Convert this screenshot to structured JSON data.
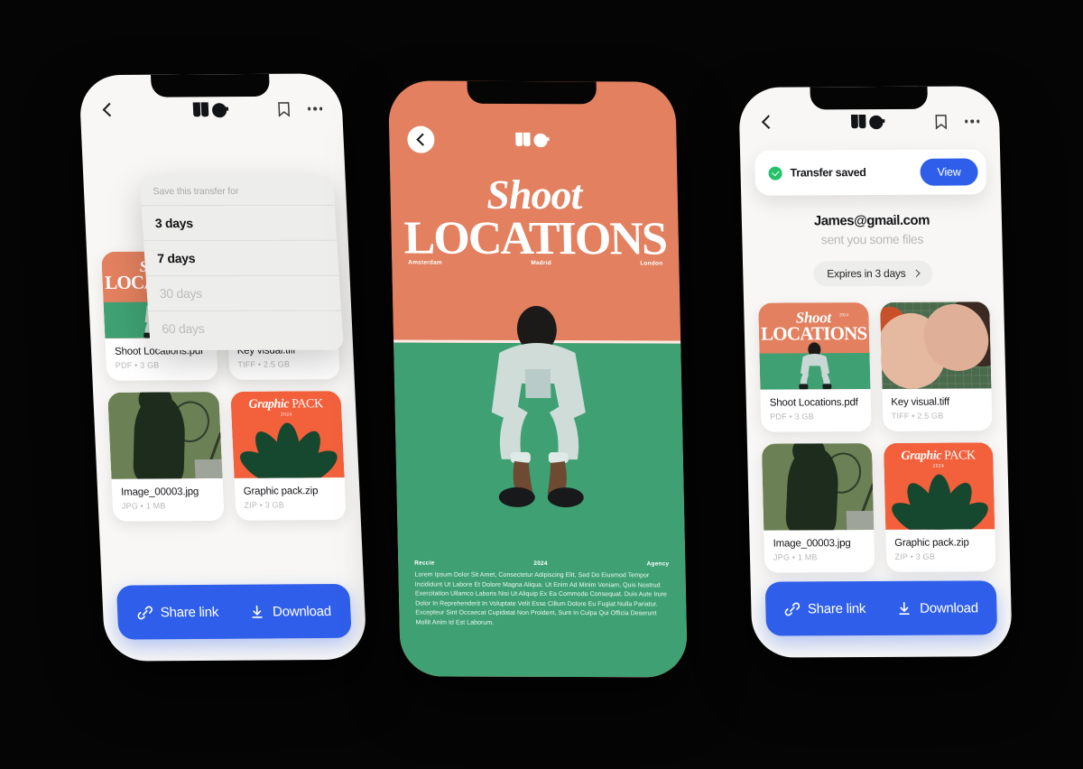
{
  "background_color": "#050505",
  "palette": {
    "orange": "#E2805F",
    "orange_bright": "#F2603C",
    "green": "#3FA173",
    "green_dark": "#16472F",
    "blue": "#2F5FEA",
    "success_green": "#25C16A",
    "surface": "#F8F7F5"
  },
  "phone1": {
    "name": "transfer-detail-with-expiry-dropdown",
    "topbar": {
      "back_icon": "chevron-left-icon",
      "logo": "we-logo",
      "bookmark_icon": "bookmark-icon",
      "more_icon": "more-horizontal-icon"
    },
    "dropdown": {
      "header": "Save this transfer for",
      "options": [
        {
          "label": "3 days",
          "state": "active"
        },
        {
          "label": "7 days",
          "state": "active"
        },
        {
          "label": "30 days",
          "state": "muted"
        },
        {
          "label": "60 days",
          "state": "muted"
        }
      ]
    },
    "files": [
      {
        "name": "Shoot Locations.pdf",
        "sub": "PDF  •  3 GB",
        "art": "shoot-cover"
      },
      {
        "name": "Key visual.tiff",
        "sub": "TIFF  •  2.5 GB",
        "art": "faces-photo"
      },
      {
        "name": "Image_00003.jpg",
        "sub": "JPG  •  1 MB",
        "art": "court-shadow"
      },
      {
        "name": "Graphic pack.zip",
        "sub": "ZIP  •  3 GB",
        "art": "graphic-pack"
      }
    ],
    "actions": {
      "share_icon": "link-icon",
      "share_label": "Share link",
      "download_icon": "download-icon",
      "download_label": "Download"
    }
  },
  "phone2": {
    "name": "shoot-locations-cover",
    "back_icon": "chevron-left-circle-icon",
    "logo": "we-logo",
    "title_line1": "Shoot",
    "title_line2": "LOCATIONS",
    "cities": [
      "Amsterdam",
      "Madrid",
      "London"
    ],
    "footer": {
      "left": "Reccie",
      "center": "2024",
      "right": "Agency",
      "body": "Lorem Ipsum Dolor Sit Amet, Consectetur Adipiscing Elit, Sed Do Eiusmod Tempor Incididunt Ut Labore Et Dolore Magna Aliqua. Ut Enim Ad Minim Veniam, Quis Nostrud Exercitation Ullamco Laboris Nisi Ut Aliquip Ex Ea Commodo Consequat. Duis Aute Irure Dolor In Reprehenderit In Voluptate Velit Esse Cillum Dolore Eu Fugiat Nulla Pariatur. Excepteur Sint Occaecat Cupidatat Non Proident, Sunt In Culpa Qui Officia Deserunt Mollit Anim Id Est Laborum."
    }
  },
  "phone3": {
    "name": "transfer-saved-confirmation",
    "topbar": {
      "back_icon": "chevron-left-icon",
      "logo": "we-logo",
      "bookmark_icon": "bookmark-icon",
      "more_icon": "more-horizontal-icon"
    },
    "toast": {
      "status_icon": "check-circle-icon",
      "message": "Transfer saved",
      "button_label": "View"
    },
    "sender_email": "James@gmail.com",
    "sender_subtitle": "sent you some files",
    "expires_label": "Expires in 3 days",
    "expires_chevron": "chevron-right-icon",
    "files": [
      {
        "name": "Shoot Locations.pdf",
        "sub": "PDF  •  3 GB",
        "art": "shoot-cover"
      },
      {
        "name": "Key visual.tiff",
        "sub": "TIFF  •  2.5 GB",
        "art": "faces-photo"
      },
      {
        "name": "Image_00003.jpg",
        "sub": "JPG  •  1 MB",
        "art": "court-shadow"
      },
      {
        "name": "Graphic pack.zip",
        "sub": "ZIP  •  3 GB",
        "art": "graphic-pack"
      }
    ],
    "actions": {
      "share_icon": "link-icon",
      "share_label": "Share link",
      "download_icon": "download-icon",
      "download_label": "Download"
    }
  },
  "art_text": {
    "shoot_l1": "Shoot",
    "shoot_l2": "LOCATIONS",
    "shoot_year": "2024",
    "pack_italic": "Graphic",
    "pack_roman": "PACK",
    "pack_year": "2024"
  }
}
